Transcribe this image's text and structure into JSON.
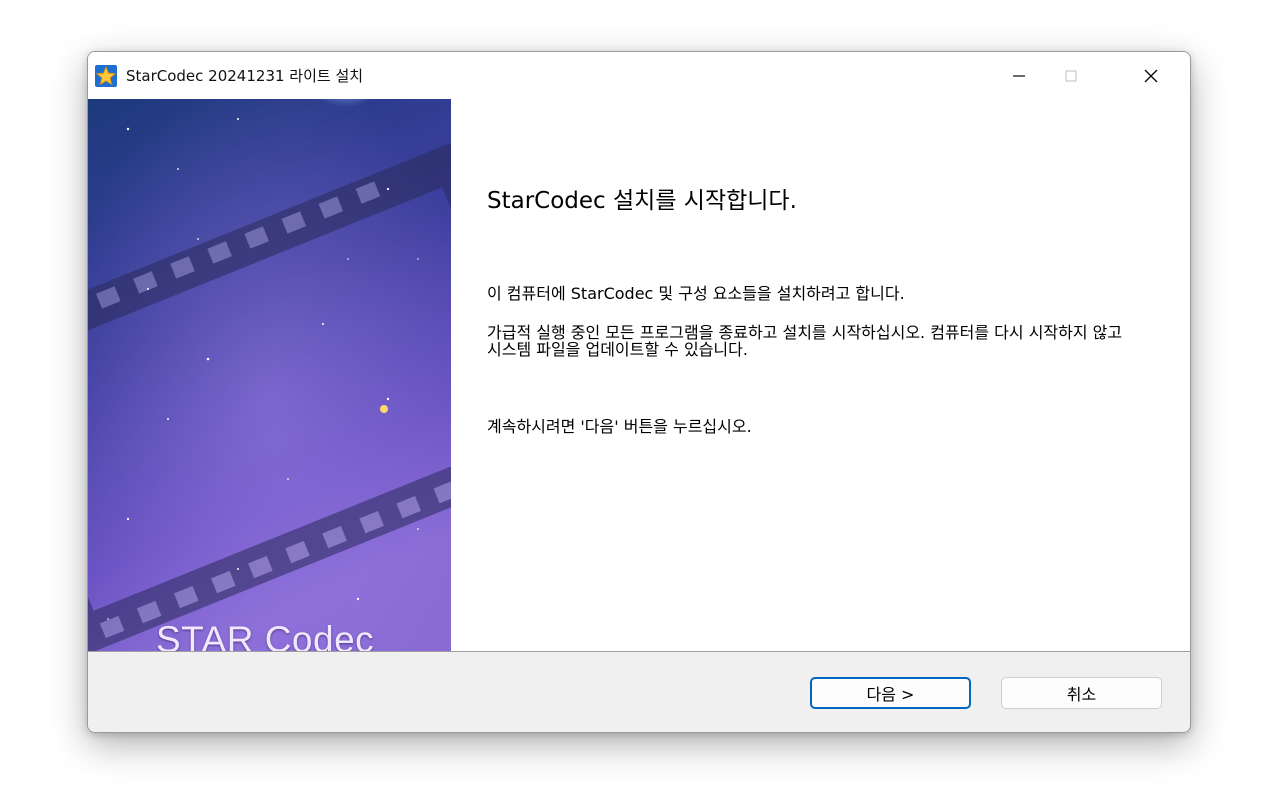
{
  "window": {
    "title": "StarCodec 20241231 라이트 설치",
    "controls": {
      "minimize_icon": "minimize-icon",
      "maximize_icon": "maximize-icon",
      "close_icon": "close-icon"
    }
  },
  "banner": {
    "label": "STAR Codec"
  },
  "content": {
    "heading": "StarCodec 설치를 시작합니다.",
    "paragraph1": "이 컴퓨터에 StarCodec 및 구성 요소들을 설치하려고 합니다.",
    "paragraph2": "가급적 실행 중인 모든 프로그램을 종료하고 설치를 시작하십시오. 컴퓨터를 다시 시작하지 않고 시스템 파일을 업데이트할 수 있습니다.",
    "paragraph3": "계속하시려면 '다음' 버튼을 누르십시오."
  },
  "footer": {
    "next_label": "다음 >",
    "cancel_label": "취소"
  },
  "colors": {
    "accent": "#0067c0",
    "footer_bg": "#f0f0f0"
  }
}
